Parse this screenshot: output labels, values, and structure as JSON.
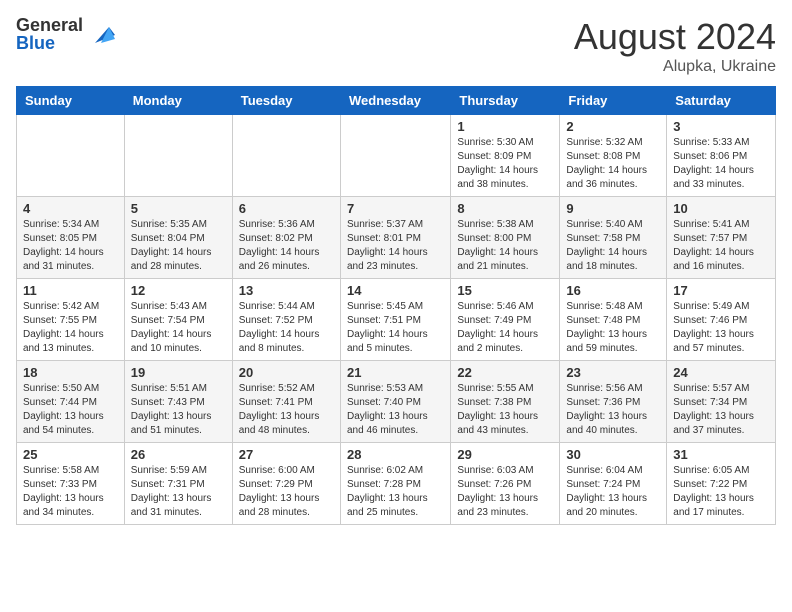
{
  "header": {
    "logo_general": "General",
    "logo_blue": "Blue",
    "month_title": "August 2024",
    "subtitle": "Alupka, Ukraine"
  },
  "days_of_week": [
    "Sunday",
    "Monday",
    "Tuesday",
    "Wednesday",
    "Thursday",
    "Friday",
    "Saturday"
  ],
  "weeks": [
    [
      {
        "day": "",
        "content": ""
      },
      {
        "day": "",
        "content": ""
      },
      {
        "day": "",
        "content": ""
      },
      {
        "day": "",
        "content": ""
      },
      {
        "day": "1",
        "content": "Sunrise: 5:30 AM\nSunset: 8:09 PM\nDaylight: 14 hours\nand 38 minutes."
      },
      {
        "day": "2",
        "content": "Sunrise: 5:32 AM\nSunset: 8:08 PM\nDaylight: 14 hours\nand 36 minutes."
      },
      {
        "day": "3",
        "content": "Sunrise: 5:33 AM\nSunset: 8:06 PM\nDaylight: 14 hours\nand 33 minutes."
      }
    ],
    [
      {
        "day": "4",
        "content": "Sunrise: 5:34 AM\nSunset: 8:05 PM\nDaylight: 14 hours\nand 31 minutes."
      },
      {
        "day": "5",
        "content": "Sunrise: 5:35 AM\nSunset: 8:04 PM\nDaylight: 14 hours\nand 28 minutes."
      },
      {
        "day": "6",
        "content": "Sunrise: 5:36 AM\nSunset: 8:02 PM\nDaylight: 14 hours\nand 26 minutes."
      },
      {
        "day": "7",
        "content": "Sunrise: 5:37 AM\nSunset: 8:01 PM\nDaylight: 14 hours\nand 23 minutes."
      },
      {
        "day": "8",
        "content": "Sunrise: 5:38 AM\nSunset: 8:00 PM\nDaylight: 14 hours\nand 21 minutes."
      },
      {
        "day": "9",
        "content": "Sunrise: 5:40 AM\nSunset: 7:58 PM\nDaylight: 14 hours\nand 18 minutes."
      },
      {
        "day": "10",
        "content": "Sunrise: 5:41 AM\nSunset: 7:57 PM\nDaylight: 14 hours\nand 16 minutes."
      }
    ],
    [
      {
        "day": "11",
        "content": "Sunrise: 5:42 AM\nSunset: 7:55 PM\nDaylight: 14 hours\nand 13 minutes."
      },
      {
        "day": "12",
        "content": "Sunrise: 5:43 AM\nSunset: 7:54 PM\nDaylight: 14 hours\nand 10 minutes."
      },
      {
        "day": "13",
        "content": "Sunrise: 5:44 AM\nSunset: 7:52 PM\nDaylight: 14 hours\nand 8 minutes."
      },
      {
        "day": "14",
        "content": "Sunrise: 5:45 AM\nSunset: 7:51 PM\nDaylight: 14 hours\nand 5 minutes."
      },
      {
        "day": "15",
        "content": "Sunrise: 5:46 AM\nSunset: 7:49 PM\nDaylight: 14 hours\nand 2 minutes."
      },
      {
        "day": "16",
        "content": "Sunrise: 5:48 AM\nSunset: 7:48 PM\nDaylight: 13 hours\nand 59 minutes."
      },
      {
        "day": "17",
        "content": "Sunrise: 5:49 AM\nSunset: 7:46 PM\nDaylight: 13 hours\nand 57 minutes."
      }
    ],
    [
      {
        "day": "18",
        "content": "Sunrise: 5:50 AM\nSunset: 7:44 PM\nDaylight: 13 hours\nand 54 minutes."
      },
      {
        "day": "19",
        "content": "Sunrise: 5:51 AM\nSunset: 7:43 PM\nDaylight: 13 hours\nand 51 minutes."
      },
      {
        "day": "20",
        "content": "Sunrise: 5:52 AM\nSunset: 7:41 PM\nDaylight: 13 hours\nand 48 minutes."
      },
      {
        "day": "21",
        "content": "Sunrise: 5:53 AM\nSunset: 7:40 PM\nDaylight: 13 hours\nand 46 minutes."
      },
      {
        "day": "22",
        "content": "Sunrise: 5:55 AM\nSunset: 7:38 PM\nDaylight: 13 hours\nand 43 minutes."
      },
      {
        "day": "23",
        "content": "Sunrise: 5:56 AM\nSunset: 7:36 PM\nDaylight: 13 hours\nand 40 minutes."
      },
      {
        "day": "24",
        "content": "Sunrise: 5:57 AM\nSunset: 7:34 PM\nDaylight: 13 hours\nand 37 minutes."
      }
    ],
    [
      {
        "day": "25",
        "content": "Sunrise: 5:58 AM\nSunset: 7:33 PM\nDaylight: 13 hours\nand 34 minutes."
      },
      {
        "day": "26",
        "content": "Sunrise: 5:59 AM\nSunset: 7:31 PM\nDaylight: 13 hours\nand 31 minutes."
      },
      {
        "day": "27",
        "content": "Sunrise: 6:00 AM\nSunset: 7:29 PM\nDaylight: 13 hours\nand 28 minutes."
      },
      {
        "day": "28",
        "content": "Sunrise: 6:02 AM\nSunset: 7:28 PM\nDaylight: 13 hours\nand 25 minutes."
      },
      {
        "day": "29",
        "content": "Sunrise: 6:03 AM\nSunset: 7:26 PM\nDaylight: 13 hours\nand 23 minutes."
      },
      {
        "day": "30",
        "content": "Sunrise: 6:04 AM\nSunset: 7:24 PM\nDaylight: 13 hours\nand 20 minutes."
      },
      {
        "day": "31",
        "content": "Sunrise: 6:05 AM\nSunset: 7:22 PM\nDaylight: 13 hours\nand 17 minutes."
      }
    ]
  ]
}
